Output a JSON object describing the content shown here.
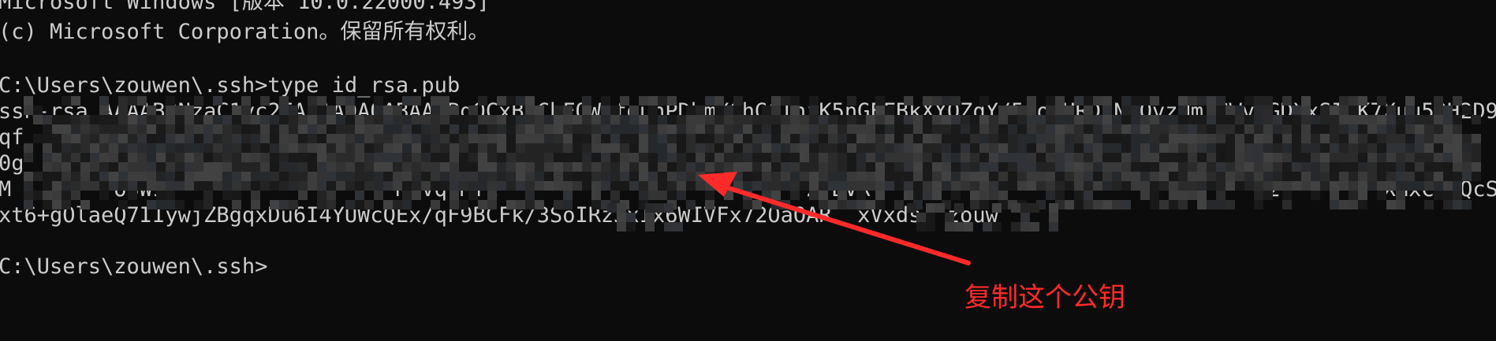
{
  "terminal": {
    "lines": [
      "Microsoft Windows [版本 10.0.22000.493]",
      "(c) Microsoft Corporation。保留所有权利。",
      "",
      "C:\\Users\\zouwen\\.ssh>type id_rsa.pub",
      "ssh-rsa AAAAB3NzaC1yc2EAAAADAQABAAABgQCxBuChFOWmfguhPDbmX6hGCTniK5nGEFBkXYQZqY/5voUHRDzN1OvzHmlGWv2GDXxSIdK7Xuu5QH2D9MC",
      "qf  1MnGaDG        9      2+JSU1FUWkp44BfRUzDE2TRFhnN0TiGTbMnkjSHDP87W5+z3+j1JH         +txDYe/8xed3KlpRG5f3T  l       anwXK3i",
      "0g  Kn5lY   50W              iyZ         xd2XtuR1                 JgHhnlGgG7         Q        /7Hc     3YxAv5Y",
      "M       7o3W9                  MkVqrMfi                        2PBVR                              02Y       XHxCtoQcSNDoRF4I",
      "xt6+gOlaeQ7IIywjZBgqxDu6I4YUWcQEx/qF9BCFk/3SoIRzJxIx6WIVFx72OaOAR  xVxds= zouw",
      "",
      "C:\\Users\\zouwen\\.ssh>"
    ]
  },
  "annotation": {
    "label": "复制这个公钥",
    "color": "#ff2a2a"
  }
}
